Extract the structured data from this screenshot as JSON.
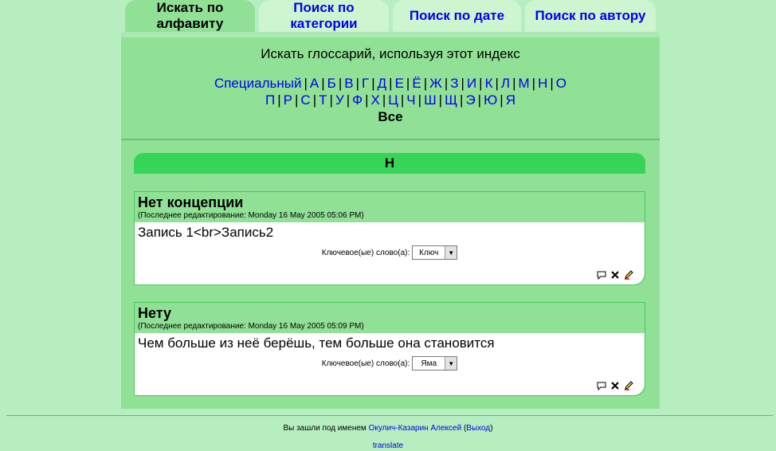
{
  "tabs": [
    {
      "label": "Искать по алфавиту",
      "selected": true
    },
    {
      "label": "Поиск по категории",
      "selected": false
    },
    {
      "label": "Поиск по дате",
      "selected": false
    },
    {
      "label": "Поиск по автору",
      "selected": false
    }
  ],
  "index": {
    "title": "Искать глоссарий, используя этот индекс",
    "special": "Специальный",
    "row1": [
      "А",
      "Б",
      "В",
      "Г",
      "Д",
      "Е",
      "Ё",
      "Ж",
      "З",
      "И",
      "К",
      "Л",
      "М",
      "Н",
      "О"
    ],
    "row2": [
      "П",
      "Р",
      "С",
      "Т",
      "У",
      "Ф",
      "Х",
      "Ц",
      "Ч",
      "Ш",
      "Щ",
      "Э",
      "Ю",
      "Я"
    ],
    "all": "Все"
  },
  "current_letter": "Н",
  "entries": [
    {
      "title": "Нет концепции",
      "edited": "(Последнее редактирование: Monday 16 May 2005 05:06 PM)",
      "definition": "Запись 1<br>Запись2",
      "keyword_label": "Ключевое(ые) слово(а):",
      "keyword_value": "Ключ"
    },
    {
      "title": "Нету",
      "edited": "(Последнее редактирование: Monday 16 May 2005 05:09 PM)",
      "definition": "Чем больше из неё берёшь, тем больше она становится",
      "keyword_label": "Ключевое(ые) слово(а):",
      "keyword_value": "Яма"
    }
  ],
  "footer": {
    "login_prefix": "Вы зашли под именем",
    "user": "Окулич-Казарин Алексей",
    "paren_open": "(",
    "logout": "Выход",
    "paren_close": ")",
    "translate": "translate"
  },
  "icons": {
    "comment": "comment-icon",
    "delete": "delete-icon",
    "edit": "edit-icon"
  }
}
